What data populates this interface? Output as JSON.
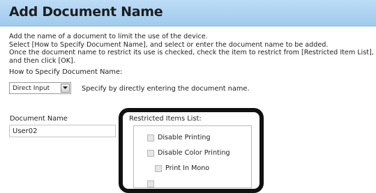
{
  "header": {
    "title": "Add Document Name"
  },
  "description": {
    "lines": [
      "Add the name of a document to limit the use of the device.",
      "Select [How to Specify Document Name], and select or enter the document name to be added.",
      "Once the document name to restrict its use is checked, check the item to restrict from [Restricted Item List],",
      "and then click [OK]."
    ]
  },
  "how_to": {
    "label": "How to Specify Document Name:",
    "selected": "Direct Input",
    "hint": "Specify by directly entering the document name."
  },
  "document_name": {
    "label": "Document Name",
    "value": "User02"
  },
  "restricted": {
    "label": "Restricted Items List:",
    "items": [
      {
        "label": "Disable Printing",
        "checked": false
      },
      {
        "label": "Disable Color Printing",
        "checked": false
      },
      {
        "label": "Print In Mono",
        "checked": false
      }
    ]
  }
}
